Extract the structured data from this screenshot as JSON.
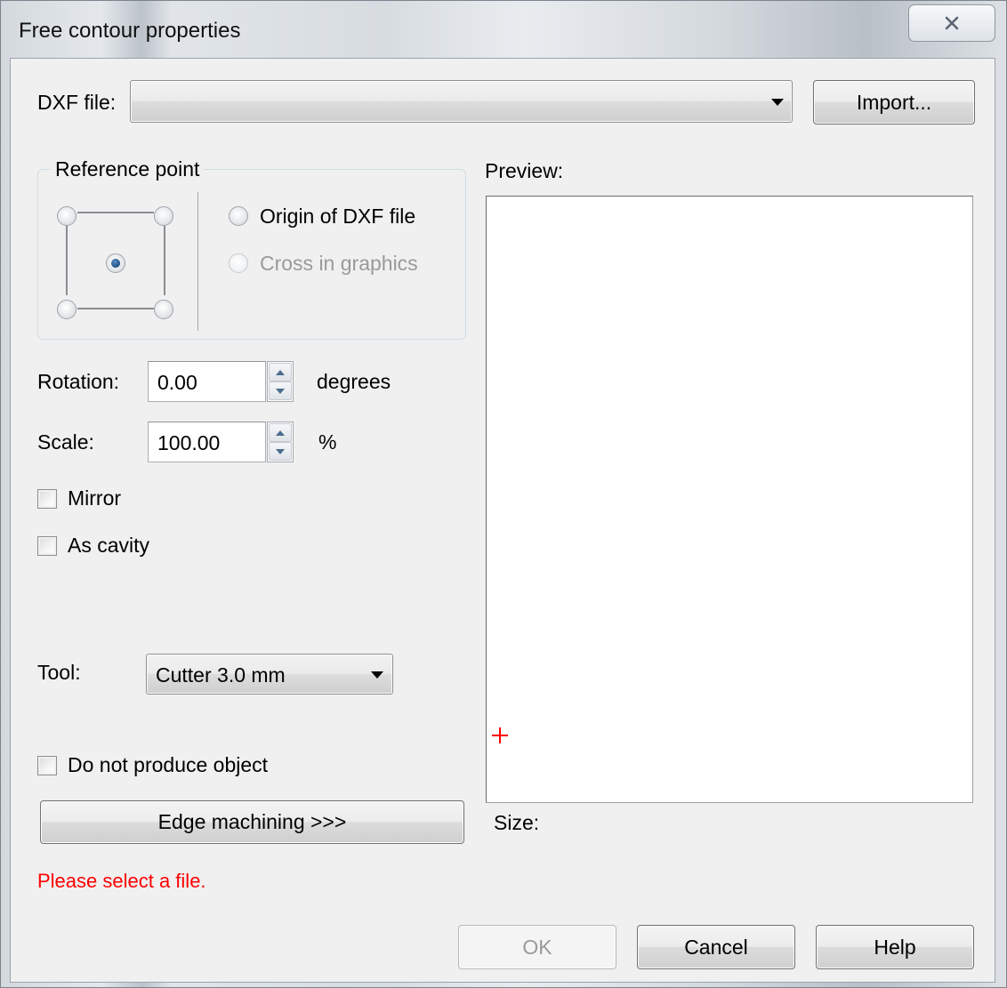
{
  "window": {
    "title": "Free contour properties"
  },
  "dxf_file": {
    "label": "DXF file:",
    "value": "",
    "import_label": "Import..."
  },
  "reference_point": {
    "title": "Reference point",
    "selected_grid_point": "center",
    "options": [
      {
        "label": "Origin of DXF file",
        "checked": false,
        "enabled": true
      },
      {
        "label": "Cross in graphics",
        "checked": false,
        "enabled": false
      }
    ]
  },
  "rotation": {
    "label": "Rotation:",
    "value": "0.00",
    "unit": "degrees"
  },
  "scale": {
    "label": "Scale:",
    "value": "100.00",
    "unit": "%"
  },
  "mirror": {
    "label": "Mirror",
    "checked": false
  },
  "as_cavity": {
    "label": "As cavity",
    "checked": false
  },
  "tool": {
    "label": "Tool:",
    "value": "Cutter 3.0 mm"
  },
  "do_not_produce": {
    "label": "Do not produce object",
    "checked": false
  },
  "edge_machining": {
    "label": "Edge machining >>>"
  },
  "status": {
    "message": "Please select a file.",
    "color": "#ff0000"
  },
  "preview": {
    "label": "Preview:",
    "size_label": "Size:"
  },
  "buttons": {
    "ok": "OK",
    "ok_enabled": false,
    "cancel": "Cancel",
    "help": "Help"
  }
}
